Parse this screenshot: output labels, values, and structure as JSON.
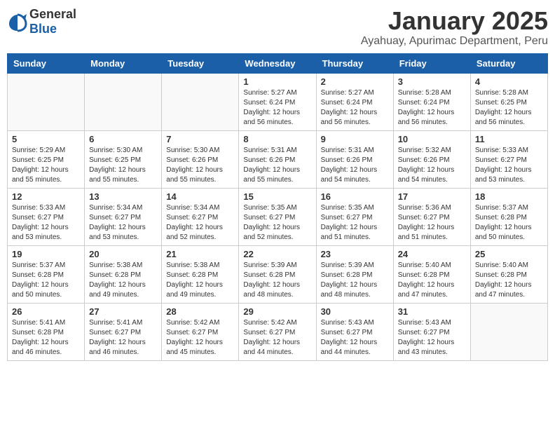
{
  "header": {
    "logo_general": "General",
    "logo_blue": "Blue",
    "month_title": "January 2025",
    "location": "Ayahuay, Apurimac Department, Peru"
  },
  "weekdays": [
    "Sunday",
    "Monday",
    "Tuesday",
    "Wednesday",
    "Thursday",
    "Friday",
    "Saturday"
  ],
  "weeks": [
    [
      {
        "day": "",
        "info": ""
      },
      {
        "day": "",
        "info": ""
      },
      {
        "day": "",
        "info": ""
      },
      {
        "day": "1",
        "info": "Sunrise: 5:27 AM\nSunset: 6:24 PM\nDaylight: 12 hours\nand 56 minutes."
      },
      {
        "day": "2",
        "info": "Sunrise: 5:27 AM\nSunset: 6:24 PM\nDaylight: 12 hours\nand 56 minutes."
      },
      {
        "day": "3",
        "info": "Sunrise: 5:28 AM\nSunset: 6:24 PM\nDaylight: 12 hours\nand 56 minutes."
      },
      {
        "day": "4",
        "info": "Sunrise: 5:28 AM\nSunset: 6:25 PM\nDaylight: 12 hours\nand 56 minutes."
      }
    ],
    [
      {
        "day": "5",
        "info": "Sunrise: 5:29 AM\nSunset: 6:25 PM\nDaylight: 12 hours\nand 55 minutes."
      },
      {
        "day": "6",
        "info": "Sunrise: 5:30 AM\nSunset: 6:25 PM\nDaylight: 12 hours\nand 55 minutes."
      },
      {
        "day": "7",
        "info": "Sunrise: 5:30 AM\nSunset: 6:26 PM\nDaylight: 12 hours\nand 55 minutes."
      },
      {
        "day": "8",
        "info": "Sunrise: 5:31 AM\nSunset: 6:26 PM\nDaylight: 12 hours\nand 55 minutes."
      },
      {
        "day": "9",
        "info": "Sunrise: 5:31 AM\nSunset: 6:26 PM\nDaylight: 12 hours\nand 54 minutes."
      },
      {
        "day": "10",
        "info": "Sunrise: 5:32 AM\nSunset: 6:26 PM\nDaylight: 12 hours\nand 54 minutes."
      },
      {
        "day": "11",
        "info": "Sunrise: 5:33 AM\nSunset: 6:27 PM\nDaylight: 12 hours\nand 53 minutes."
      }
    ],
    [
      {
        "day": "12",
        "info": "Sunrise: 5:33 AM\nSunset: 6:27 PM\nDaylight: 12 hours\nand 53 minutes."
      },
      {
        "day": "13",
        "info": "Sunrise: 5:34 AM\nSunset: 6:27 PM\nDaylight: 12 hours\nand 53 minutes."
      },
      {
        "day": "14",
        "info": "Sunrise: 5:34 AM\nSunset: 6:27 PM\nDaylight: 12 hours\nand 52 minutes."
      },
      {
        "day": "15",
        "info": "Sunrise: 5:35 AM\nSunset: 6:27 PM\nDaylight: 12 hours\nand 52 minutes."
      },
      {
        "day": "16",
        "info": "Sunrise: 5:35 AM\nSunset: 6:27 PM\nDaylight: 12 hours\nand 51 minutes."
      },
      {
        "day": "17",
        "info": "Sunrise: 5:36 AM\nSunset: 6:27 PM\nDaylight: 12 hours\nand 51 minutes."
      },
      {
        "day": "18",
        "info": "Sunrise: 5:37 AM\nSunset: 6:28 PM\nDaylight: 12 hours\nand 50 minutes."
      }
    ],
    [
      {
        "day": "19",
        "info": "Sunrise: 5:37 AM\nSunset: 6:28 PM\nDaylight: 12 hours\nand 50 minutes."
      },
      {
        "day": "20",
        "info": "Sunrise: 5:38 AM\nSunset: 6:28 PM\nDaylight: 12 hours\nand 49 minutes."
      },
      {
        "day": "21",
        "info": "Sunrise: 5:38 AM\nSunset: 6:28 PM\nDaylight: 12 hours\nand 49 minutes."
      },
      {
        "day": "22",
        "info": "Sunrise: 5:39 AM\nSunset: 6:28 PM\nDaylight: 12 hours\nand 48 minutes."
      },
      {
        "day": "23",
        "info": "Sunrise: 5:39 AM\nSunset: 6:28 PM\nDaylight: 12 hours\nand 48 minutes."
      },
      {
        "day": "24",
        "info": "Sunrise: 5:40 AM\nSunset: 6:28 PM\nDaylight: 12 hours\nand 47 minutes."
      },
      {
        "day": "25",
        "info": "Sunrise: 5:40 AM\nSunset: 6:28 PM\nDaylight: 12 hours\nand 47 minutes."
      }
    ],
    [
      {
        "day": "26",
        "info": "Sunrise: 5:41 AM\nSunset: 6:28 PM\nDaylight: 12 hours\nand 46 minutes."
      },
      {
        "day": "27",
        "info": "Sunrise: 5:41 AM\nSunset: 6:27 PM\nDaylight: 12 hours\nand 46 minutes."
      },
      {
        "day": "28",
        "info": "Sunrise: 5:42 AM\nSunset: 6:27 PM\nDaylight: 12 hours\nand 45 minutes."
      },
      {
        "day": "29",
        "info": "Sunrise: 5:42 AM\nSunset: 6:27 PM\nDaylight: 12 hours\nand 44 minutes."
      },
      {
        "day": "30",
        "info": "Sunrise: 5:43 AM\nSunset: 6:27 PM\nDaylight: 12 hours\nand 44 minutes."
      },
      {
        "day": "31",
        "info": "Sunrise: 5:43 AM\nSunset: 6:27 PM\nDaylight: 12 hours\nand 43 minutes."
      },
      {
        "day": "",
        "info": ""
      }
    ]
  ]
}
